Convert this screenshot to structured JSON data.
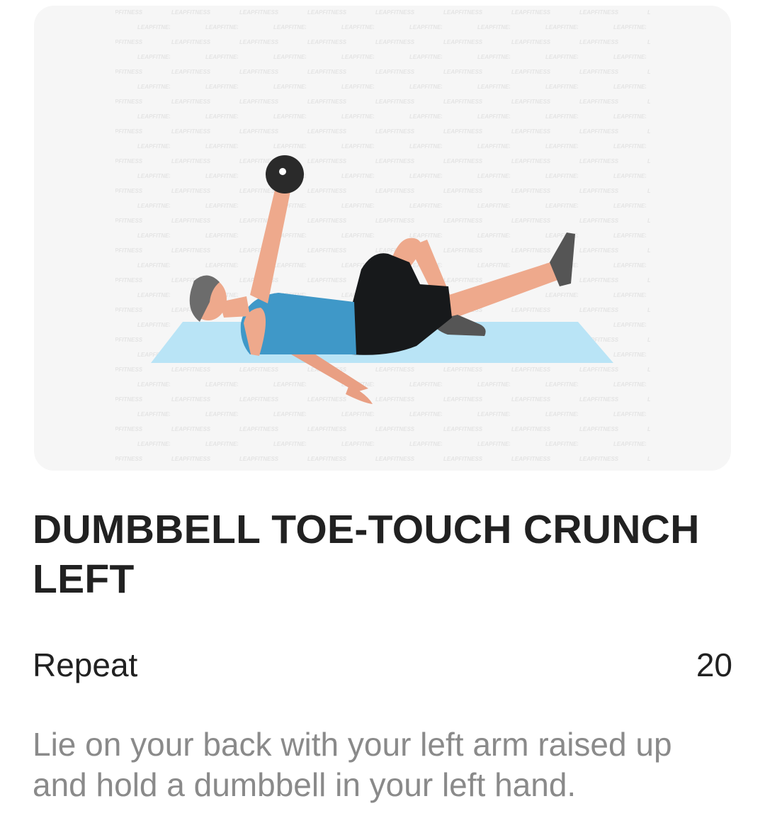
{
  "exercise": {
    "image": {
      "illustration_name": "dumbbell-toe-touch-crunch-illustration",
      "watermark_text": "LEAPFITNESS",
      "colors": {
        "mat": "#b9e4f6",
        "shirt": "#3f98c8",
        "shorts": "#17191b",
        "skin": "#eea98c",
        "hair": "#6c6c6c",
        "dumbbell": "#2a2a2a"
      }
    },
    "title": "DUMBBELL TOE-TOUCH CRUNCH LEFT",
    "repeat": {
      "label": "Repeat",
      "value": "20"
    },
    "description": "Lie on your back with your left arm raised up and hold a dumbbell in your left hand."
  }
}
